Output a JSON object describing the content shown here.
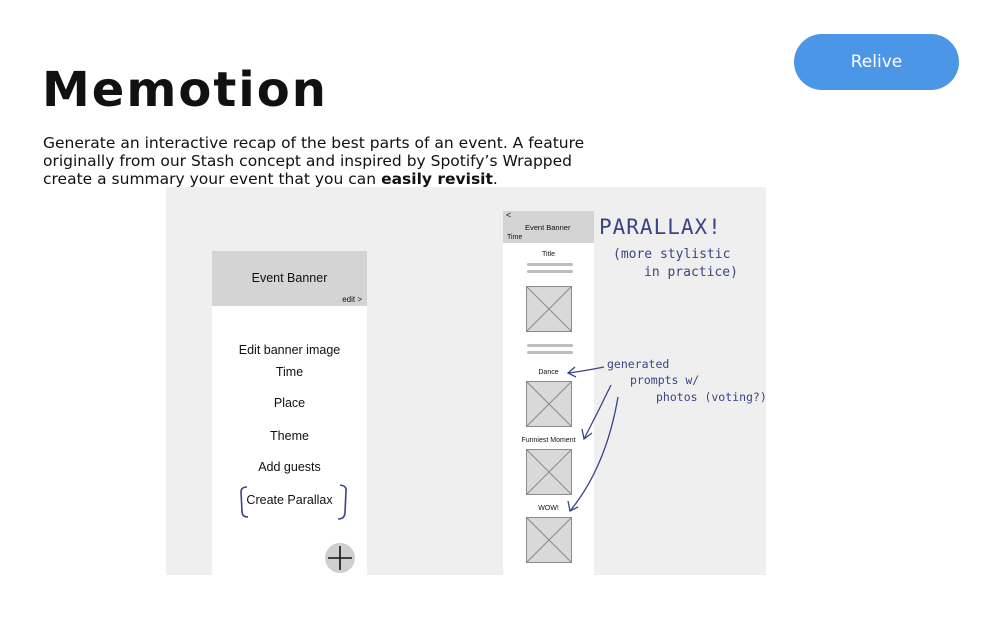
{
  "header": {
    "title": "Memotion",
    "cta_label": "Relive",
    "description_1": "Generate an interactive recap of the best parts of an event. A feature",
    "description_2": "originally from our Stash concept and inspired by Spotify’s Wrapped",
    "description_3": "create a summary your event that you can ",
    "description_bold": "easily revisit",
    "description_end": "."
  },
  "edit_screen": {
    "banner_label": "Event Banner",
    "edit_link": "edit >",
    "items": [
      "Edit banner image",
      "Time",
      "Place",
      "Theme",
      "Add guests",
      "Create Parallax"
    ]
  },
  "parallax_screen": {
    "back": "<",
    "banner_label": "Event Banner",
    "time_label": "Time",
    "title_label": "Title",
    "prompts": [
      "Dance",
      "Funniest Moment",
      "WOW!"
    ]
  },
  "annotations": {
    "parallax": "PARALLAX!",
    "stylistic_1": "(more stylistic",
    "stylistic_2": "in practice)",
    "generated_1": "generated",
    "generated_2": "prompts w/",
    "generated_3": "photos (voting?)"
  },
  "colors": {
    "accent": "#4c96e8",
    "ink": "#3b4584",
    "wireframe_bg": "#efefef",
    "banner": "#d4d4d4"
  }
}
